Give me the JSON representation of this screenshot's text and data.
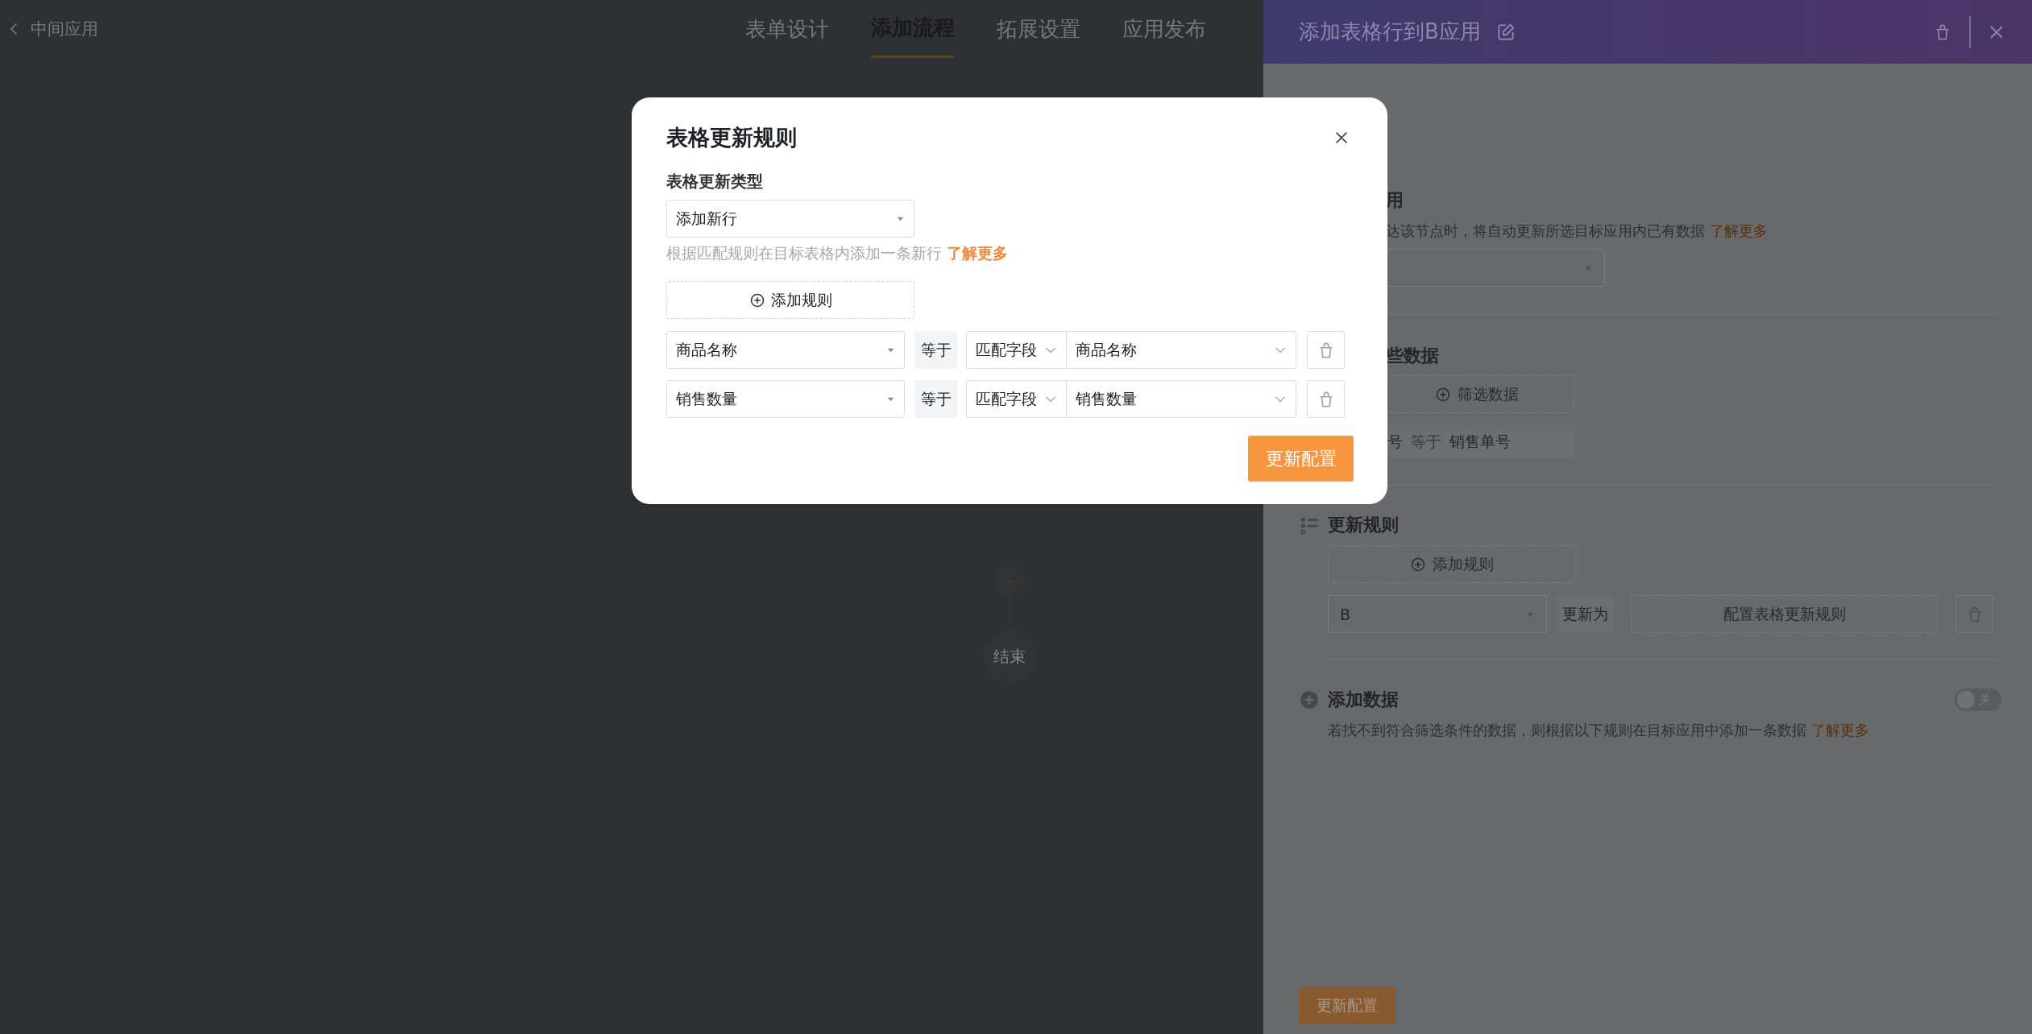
{
  "topbar": {
    "app_name": "中间应用"
  },
  "tabs": [
    {
      "label": "表单设计",
      "selected": false
    },
    {
      "label": "添加流程",
      "selected": true
    },
    {
      "label": "拓展设置",
      "selected": false
    },
    {
      "label": "应用发布",
      "selected": false
    }
  ],
  "flow": {
    "end_label": "结束"
  },
  "panel": {
    "title": "添加表格行到B应用",
    "target_app": {
      "title": "用",
      "description": "达该节点时，将自动更新所选目标应用内已有数据",
      "link": "了解更多"
    },
    "filter": {
      "title": "些数据",
      "button": "筛选数据",
      "condition": {
        "field": "号",
        "operator": "等于",
        "value": "销售单号"
      }
    },
    "update_rules": {
      "title": "更新规则",
      "add_button": "添加规则",
      "rules": [
        {
          "field": "B",
          "operator": "更新为",
          "action": "配置表格更新规则"
        }
      ]
    },
    "add_data": {
      "title": "添加数据",
      "description": "若找不到符合筛选条件的数据，则根据以下规则在目标应用中添加一条数据",
      "link": "了解更多",
      "toggle": {
        "on": false,
        "label": "关"
      }
    },
    "submit": "更新配置"
  },
  "dialog": {
    "title": "表格更新规则",
    "type_label": "表格更新类型",
    "type_value": "添加新行",
    "hint": "根据匹配规则在目标表格内添加一条新行",
    "link": "了解更多",
    "add_button": "添加规则",
    "rules": [
      {
        "field": "商品名称",
        "operator": "等于",
        "source": "匹配字段",
        "value": "商品名称"
      },
      {
        "field": "销售数量",
        "operator": "等于",
        "source": "匹配字段",
        "value": "销售数量"
      }
    ],
    "submit": "更新配置"
  }
}
